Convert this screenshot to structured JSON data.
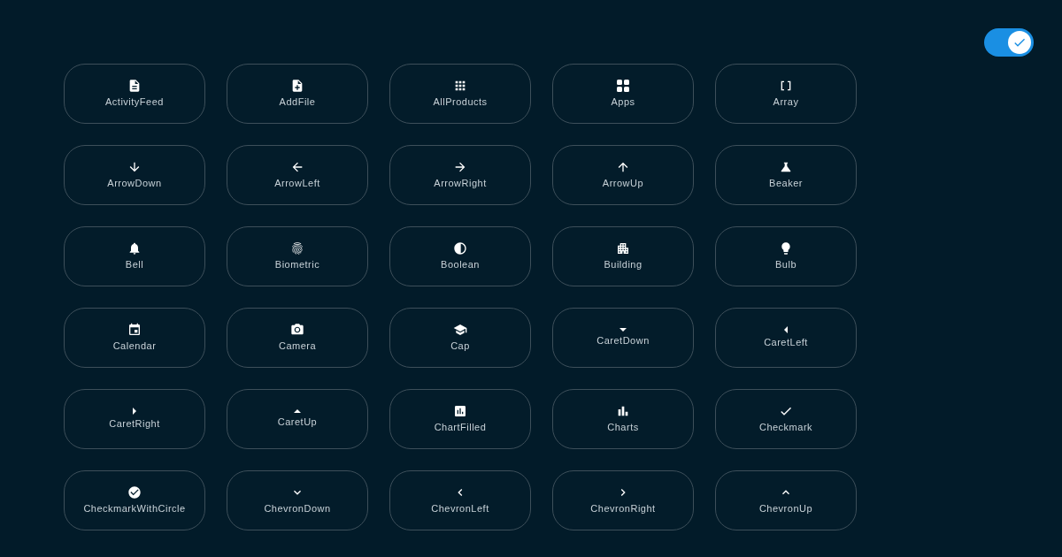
{
  "toggle": {
    "on": true
  },
  "icons": [
    {
      "label": "ActivityFeed"
    },
    {
      "label": "AddFile"
    },
    {
      "label": "AllProducts"
    },
    {
      "label": "Apps"
    },
    {
      "label": "Array"
    },
    {
      "label": "ArrowDown"
    },
    {
      "label": "ArrowLeft"
    },
    {
      "label": "ArrowRight"
    },
    {
      "label": "ArrowUp"
    },
    {
      "label": "Beaker"
    },
    {
      "label": "Bell"
    },
    {
      "label": "Biometric"
    },
    {
      "label": "Boolean"
    },
    {
      "label": "Building"
    },
    {
      "label": "Bulb"
    },
    {
      "label": "Calendar"
    },
    {
      "label": "Camera"
    },
    {
      "label": "Cap"
    },
    {
      "label": "CaretDown"
    },
    {
      "label": "CaretLeft"
    },
    {
      "label": "CaretRight"
    },
    {
      "label": "CaretUp"
    },
    {
      "label": "ChartFilled"
    },
    {
      "label": "Charts"
    },
    {
      "label": "Checkmark"
    },
    {
      "label": "CheckmarkWithCircle"
    },
    {
      "label": "ChevronDown"
    },
    {
      "label": "ChevronLeft"
    },
    {
      "label": "ChevronRight"
    },
    {
      "label": "ChevronUp"
    }
  ]
}
